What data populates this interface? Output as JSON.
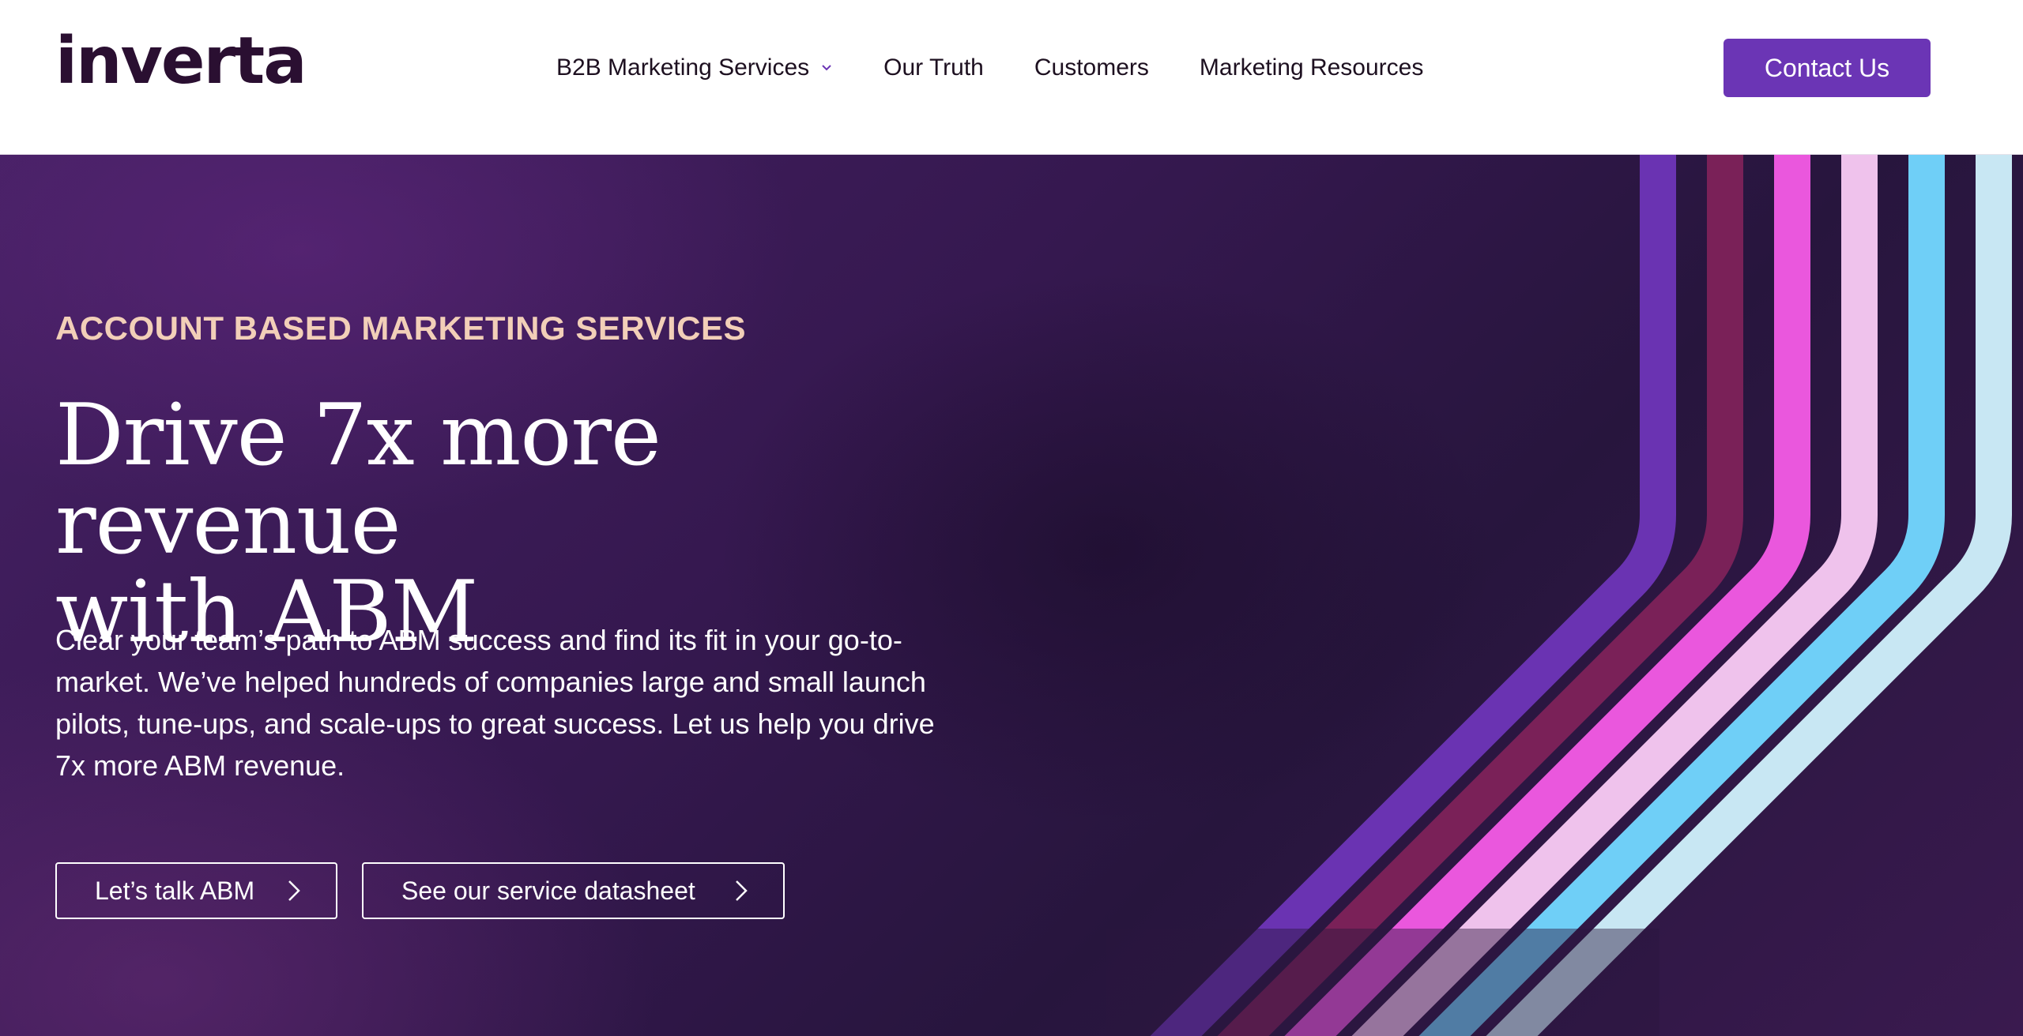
{
  "header": {
    "logo_text": "inverta",
    "nav": [
      {
        "label": "B2B Marketing Services",
        "has_dropdown": true
      },
      {
        "label": "Our Truth"
      },
      {
        "label": "Customers"
      },
      {
        "label": "Marketing Resources"
      }
    ],
    "contact_label": "Contact Us"
  },
  "hero": {
    "eyebrow": "ACCOUNT BASED MARKETING SERVICES",
    "headline_line1": "Drive 7x more revenue",
    "headline_line2": "with ABM",
    "body": "Clear your team’s path to ABM success and find its fit in your go-to-market. We’ve helped hundreds of companies large and small launch pilots, tune-ups, and scale-ups to great success. Let us help you drive 7x more ABM revenue.",
    "cta_primary": "Let’s talk ABM",
    "cta_secondary": "See our service datasheet"
  },
  "icons": {
    "dropdown": "chevron-down-icon",
    "cta_arrow": "chevron-right-icon"
  },
  "colors": {
    "brand_purple": "#6b35b5",
    "eyebrow": "#f2cfb8",
    "logo": "#2a0f31",
    "stripes": [
      "#6a33b2",
      "#7a2158",
      "#ea57dd",
      "#efc2ec",
      "#6fcff7",
      "#c8e7f3"
    ]
  }
}
